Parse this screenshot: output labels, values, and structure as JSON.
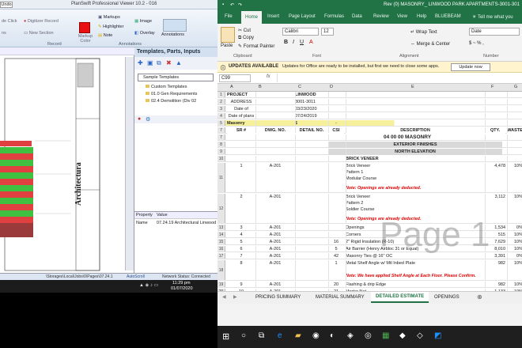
{
  "planswift": {
    "title": "PlanSwift Professional Viewer 10.2 - 016",
    "undo": "Undo",
    "ribbon": {
      "left_items": [
        "de Click",
        "ns",
        "ia",
        "xt Center"
      ],
      "digitizer_record": "Digitizer Record",
      "new_section": "New Section",
      "markups": "Markups",
      "highlighter": "Highlighter",
      "note": "Note",
      "markup_color": "Markup Color",
      "image": "Image",
      "overlay": "Overlay",
      "annotations": "Annotations",
      "group_record": "Record",
      "group_annotations": "Annotations"
    },
    "templates_panel": {
      "title": "Templates, Parts, Inputs",
      "combo": "Sample Templates",
      "tree": [
        "Custom Templates",
        "01.0 Gen Requirements",
        "02.4 Demolition (Div 02"
      ]
    },
    "properties": {
      "col1": "Property",
      "col2": "Value",
      "name_label": "Name",
      "name_value": "07.24.19 Architectural Linwood"
    },
    "status_path": "\\Storages\\Local\\Jobs\\0\\Pages\\07.24.1",
    "status_autoscroll": "AutoScroll",
    "status_network": "Network Status: Connected",
    "drawing_label": "Architectura",
    "clock": "11:29 pm",
    "date": "01/07/2020"
  },
  "excel": {
    "title": "Rev (0) MASONRY_ LINWOOD PARK APARTMENTS-3001-301",
    "tabs": [
      "File",
      "Home",
      "Insert",
      "Page Layout",
      "Formulas",
      "Data",
      "Review",
      "View",
      "Help",
      "BLUEBEAM"
    ],
    "tell_me": "Tell me what you",
    "ribbon": {
      "cut": "Cut",
      "copy": "Copy",
      "paste": "Paste",
      "format_painter": "Format Painter",
      "clipboard": "Clipboard",
      "font_name": "Calibri",
      "font_size": "12",
      "font_group": "Font",
      "wrap_text": "Wrap Text",
      "merge_center": "Merge & Center",
      "alignment": "Alignment",
      "number_format": "Date",
      "number_group": "Number"
    },
    "update_bar": {
      "title": "UPDATES AVAILABLE",
      "message": "Updates for Office are ready to be installed, but first we need to close some apps.",
      "button": "Update now"
    },
    "name_box": "C99",
    "fx": "fx",
    "columns": [
      "A",
      "B",
      "C",
      "D",
      "E",
      "F",
      "G"
    ],
    "rows": [
      {
        "n": "1",
        "a": "PROJECT",
        "c": "LINWOOD PARK APARTMENTS",
        "style": "bold"
      },
      {
        "n": "2",
        "a": "ADDRESS",
        "c": "3001-3011 EDWIN AVENUE, FORT LEE, NEW JERSEY"
      },
      {
        "n": "3",
        "a": "Date of submission",
        "c": "03/23/2020"
      },
      {
        "n": "4",
        "a": "Date of plans",
        "c": "07/24/2019"
      },
      {
        "n": "5",
        "a": "Masonry",
        "c": "$",
        "d": "-",
        "style": "masonry"
      },
      {
        "n": "7",
        "a": "SR #",
        "b": "DWG. NO.",
        "c": "DETAIL NO.",
        "d": "CSI NO.",
        "e": "DESCRIPTION",
        "f": "QTY.",
        "g": "WASTE",
        "style": "header"
      },
      {
        "n": "7",
        "e": "04 00 00  MASONRY",
        "style": "section"
      },
      {
        "n": "8",
        "e": "EXTERIOR FINISHES",
        "style": "grey"
      },
      {
        "n": "9",
        "e": "NORTH ELEVATION",
        "style": "grey"
      },
      {
        "n": "10",
        "e": "BRICK VENEER",
        "style": "bold"
      },
      {
        "n": "11",
        "a": "1",
        "b": "A-201",
        "e": "Brick Veneer\nPattern 1\nModular Course",
        "red": "Note: Openings are already deducted.",
        "f": "4,478",
        "g": "10%",
        "h": 38
      },
      {
        "n": "12",
        "a": "2",
        "b": "A-201",
        "e": "Brick Veneer\nPattern 2\nSoldier Course",
        "red": "Note: Openings are already deducted.",
        "f": "3,112",
        "g": "10%",
        "h": 38
      },
      {
        "n": "13",
        "a": "3",
        "b": "A-201",
        "e": "Openings",
        "f": "1,534",
        "g": "0%"
      },
      {
        "n": "14",
        "a": "4",
        "b": "A-201",
        "e": "Corners",
        "f": "515",
        "g": "10%"
      },
      {
        "n": "15",
        "a": "5",
        "b": "A-201",
        "d": "16",
        "e": "2\" Rigid Insulation (R-10)",
        "f": "7,629",
        "g": "10%"
      },
      {
        "n": "16",
        "a": "6",
        "b": "A-201",
        "d": "5",
        "e": "Air Barrier (Henry Airbloc 31 or Equal)",
        "f": "8,010",
        "g": "10%"
      },
      {
        "n": "17",
        "a": "7",
        "b": "A-201",
        "d": "42",
        "e": "Masonry Ties @ 16\" OC",
        "f": "3,391",
        "g": "0%"
      },
      {
        "n": "18",
        "a": "8",
        "b": "A-201",
        "d": "1",
        "e": "Metal Shelf Angle w/ Mtl Inbed Plate",
        "red": "Note: We have applied Shelf Angle at Each Floor. Please Confirm.",
        "f": "982",
        "g": "10%",
        "h": 26
      },
      {
        "n": "19",
        "a": "9",
        "b": "A-201",
        "d": "20",
        "e": "Flashing & drip Edge",
        "f": "982",
        "g": "10%"
      },
      {
        "n": "20",
        "a": "10",
        "b": "A-201",
        "d": "21",
        "e": "Mortar Net",
        "f": "1,133",
        "g": "10%"
      },
      {
        "n": "21",
        "a": "11",
        "b": "A-201",
        "d": "20",
        "e": "Weeps @ 48\" OC",
        "f": "246",
        "g": "0%"
      }
    ],
    "watermark": "Page 1",
    "sheet_tabs": [
      "PRICING SUMMARY",
      "MATERIAL SUMMARY",
      "DETAILED ESTIMATE",
      "OPENINGS"
    ],
    "active_sheet": "DETAILED ESTIMATE"
  }
}
